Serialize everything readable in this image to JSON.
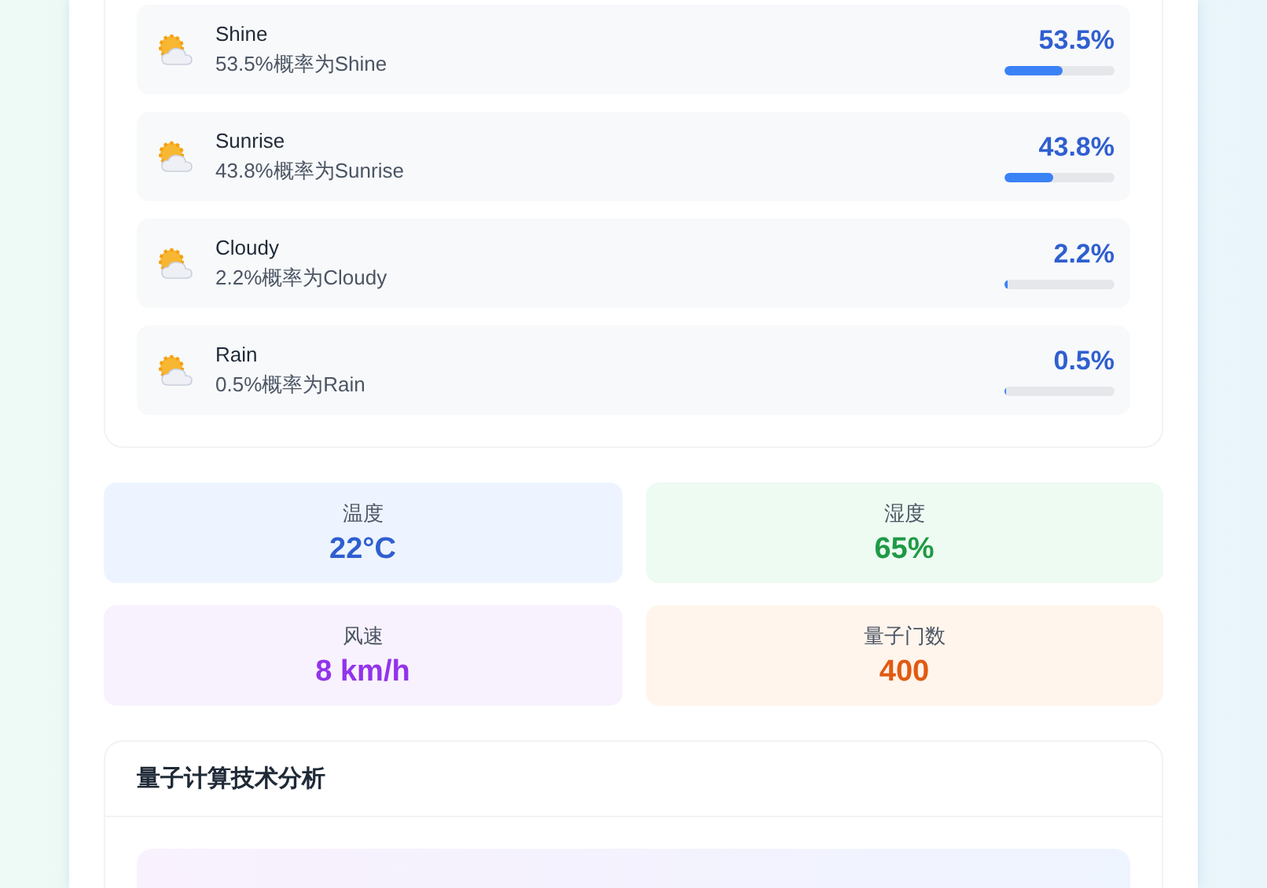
{
  "predictions": [
    {
      "label": "Shine",
      "description": "53.5%概率为Shine",
      "percent": "53.5%",
      "level": 0.535
    },
    {
      "label": "Sunrise",
      "description": "43.8%概率为Sunrise",
      "percent": "43.8%",
      "level": 0.438
    },
    {
      "label": "Cloudy",
      "description": "2.2%概率为Cloudy",
      "percent": "2.2%",
      "level": 0.022
    },
    {
      "label": "Rain",
      "description": "0.5%概率为Rain",
      "percent": "0.5%",
      "level": 0.005
    }
  ],
  "stats": [
    {
      "label": "温度",
      "value": "22°C",
      "kind": "blue"
    },
    {
      "label": "湿度",
      "value": "65%",
      "kind": "green"
    },
    {
      "label": "风速",
      "value": "8 km/h",
      "kind": "purple"
    },
    {
      "label": "量子门数",
      "value": "400",
      "kind": "orange"
    }
  ],
  "analysis": {
    "title": "量子计算技术分析"
  }
}
